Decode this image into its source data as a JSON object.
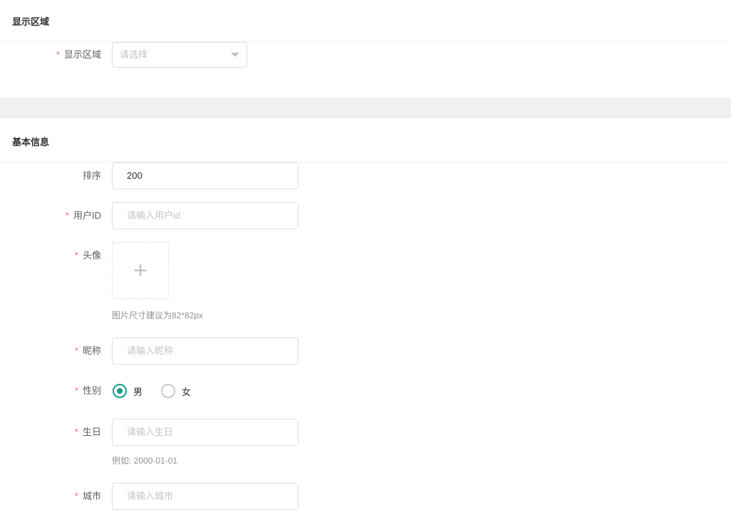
{
  "sections": {
    "display_area": {
      "title": "显示区域",
      "field_label": "显示区域",
      "select_placeholder": "请选择"
    },
    "basic_info": {
      "title": "基本信息"
    }
  },
  "fields": {
    "sort": {
      "label": "排序",
      "value": "200"
    },
    "user_id": {
      "label": "用户ID",
      "placeholder": "请输入用户id"
    },
    "avatar": {
      "label": "头像",
      "upload_icon": "+",
      "hint": "图片尺寸建议为82*82px"
    },
    "nickname": {
      "label": "昵称",
      "placeholder": "请输入昵称"
    },
    "gender": {
      "label": "性别",
      "options": [
        "男",
        "女"
      ],
      "selected": "男"
    },
    "birthday": {
      "label": "生日",
      "placeholder": "请输入生日",
      "hint": "例如: 2000-01-01"
    },
    "city": {
      "label": "城市",
      "placeholder": "请输入城市"
    }
  },
  "required_mark": "*",
  "accent_color": "#139b8c"
}
